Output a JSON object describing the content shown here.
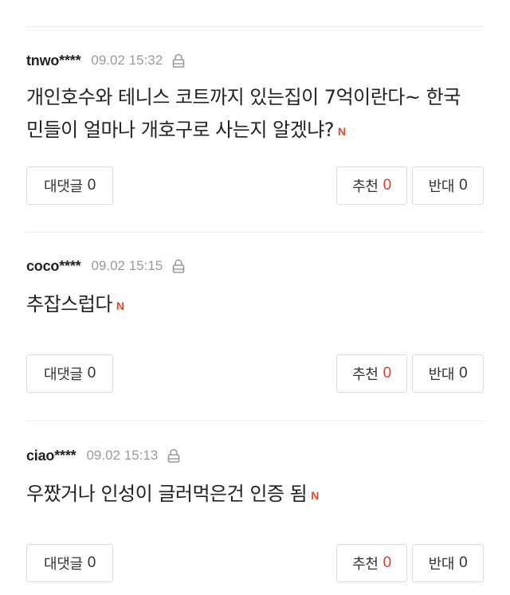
{
  "comments": [
    {
      "author": "tnwo****",
      "datetime": "09.02 15:32",
      "text_lines": [
        "개인호수와 테니스 코트까지 있는집이 7억이란다~ 한국",
        "민들이 얼마나 개호구로 사는지 알겠냐?"
      ],
      "new_badge": "N",
      "reply_label": "대댓글",
      "reply_count": "0",
      "recommend_label": "추천",
      "recommend_count": "0",
      "oppose_label": "반대",
      "oppose_count": "0"
    },
    {
      "author": "coco****",
      "datetime": "09.02 15:15",
      "text_lines": [
        "추잡스럽다"
      ],
      "new_badge": "N",
      "reply_label": "대댓글",
      "reply_count": "0",
      "recommend_label": "추천",
      "recommend_count": "0",
      "oppose_label": "반대",
      "oppose_count": "0"
    },
    {
      "author": "ciao****",
      "datetime": "09.02 15:13",
      "text_lines": [
        "우짰거나 인성이 글러먹은건 인증 됨"
      ],
      "new_badge": "N",
      "reply_label": "대댓글",
      "reply_count": "0",
      "recommend_label": "추천",
      "recommend_count": "0",
      "oppose_label": "반대",
      "oppose_count": "0"
    }
  ],
  "icons": {
    "lock": "lock-icon"
  },
  "colors": {
    "accent_red": "#e03c2d",
    "badge_red": "#e04a2d",
    "meta_gray": "#9a9a9a",
    "border": "#dcdcdc"
  }
}
